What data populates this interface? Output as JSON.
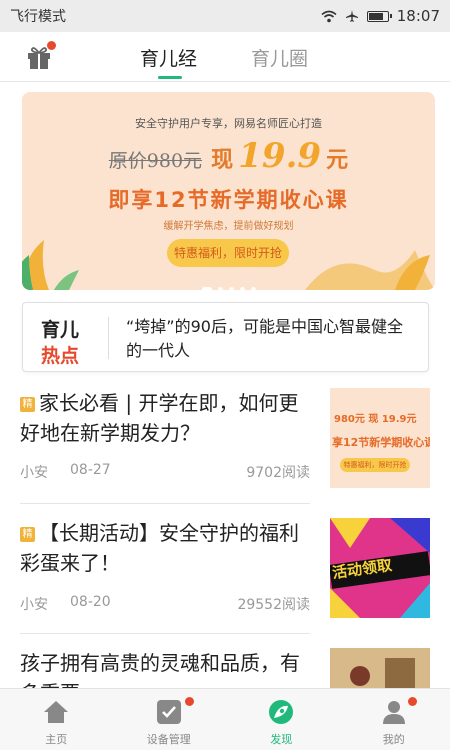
{
  "status_bar": {
    "mode": "飞行模式",
    "time": "18:07"
  },
  "header": {
    "tabs": [
      {
        "label": "育儿经",
        "active": true
      },
      {
        "label": "育儿圈",
        "active": false
      }
    ]
  },
  "banner": {
    "subtitle": "安全守护用户专享，网易名师匠心打造",
    "original_price_label": "原价980元",
    "now_label": "现",
    "now_price": "19.9",
    "now_unit": "元",
    "course_title": "即享12节新学期收心课",
    "tip": "缓解开学焦虑，提前做好规划",
    "cta": "特惠福利，限时开抢",
    "slide_count": 5,
    "active_slide": 0,
    "colors": {
      "bg": "#fbe3cf",
      "accent": "#e66a28",
      "cta_bg": "#f7c84a"
    }
  },
  "hot_news": {
    "tag_line1": "育儿",
    "tag_line2": "热点",
    "text": "“垮掉”的90后，可能是中国心智最健全的一代人"
  },
  "articles": [
    {
      "badge": "精",
      "title": "家长必看 | 开学在即，如何更好地在新学期发力？",
      "author": "小安",
      "date": "08-27",
      "reads": "9702阅读",
      "thumb_text": [
        "980元 现 19.9元",
        "享12节新学期收心课",
        "特惠福利，限时开抢"
      ]
    },
    {
      "badge": "精",
      "title": "【长期活动】安全守护的福利彩蛋来了！",
      "author": "小安",
      "date": "08-20",
      "reads": "29552阅读",
      "thumb_text": [
        "活动领取"
      ]
    },
    {
      "title": "孩子拥有高贵的灵魂和品质，有多重要"
    }
  ],
  "bottom_nav": [
    {
      "label": "主页",
      "icon": "home-icon",
      "active": false,
      "badge": false
    },
    {
      "label": "设备管理",
      "icon": "device-check-icon",
      "active": false,
      "badge": true
    },
    {
      "label": "发现",
      "icon": "discover-icon",
      "active": true,
      "badge": false
    },
    {
      "label": "我的",
      "icon": "profile-icon",
      "active": false,
      "badge": true
    }
  ],
  "colors": {
    "accent_green": "#21b97b",
    "badge_red": "#e64a2e",
    "badge_gold": "#f0b23a"
  }
}
